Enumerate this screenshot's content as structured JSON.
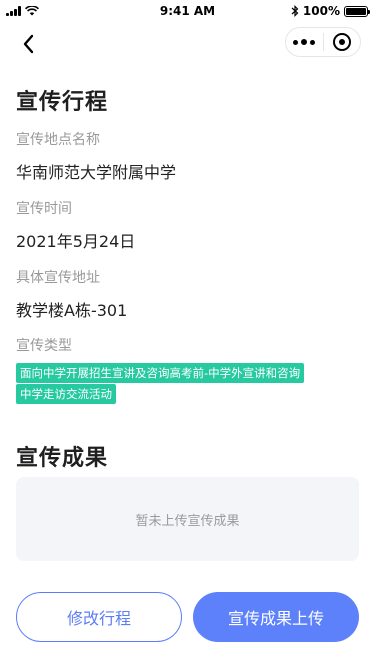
{
  "status_bar": {
    "time": "9:41 AM",
    "battery": "100%"
  },
  "page": {
    "title": "宣传行程"
  },
  "fields": [
    {
      "label": "宣传地点名称",
      "value": "华南师范大学附属中学"
    },
    {
      "label": "宣传时间",
      "value": "2021年5月24日"
    },
    {
      "label": "具体宣传地址",
      "value": "教学楼A栋-301"
    }
  ],
  "type_section": {
    "label": "宣传类型",
    "tags": [
      "面向中学开展招生宣讲及咨询高考前-中学外宣讲和咨询",
      "中学走访交流活动"
    ]
  },
  "results": {
    "title": "宣传成果",
    "empty_text": "暂未上传宣传成果"
  },
  "actions": {
    "edit_label": "修改行程",
    "upload_label": "宣传成果上传"
  },
  "colors": {
    "accent": "#5d80fb",
    "tag": "#27c9a1",
    "muted_text": "#9a9a9a"
  },
  "icons": {
    "back": "chevron-left-icon",
    "more": "more-dots-icon",
    "close": "target-circle-icon"
  }
}
